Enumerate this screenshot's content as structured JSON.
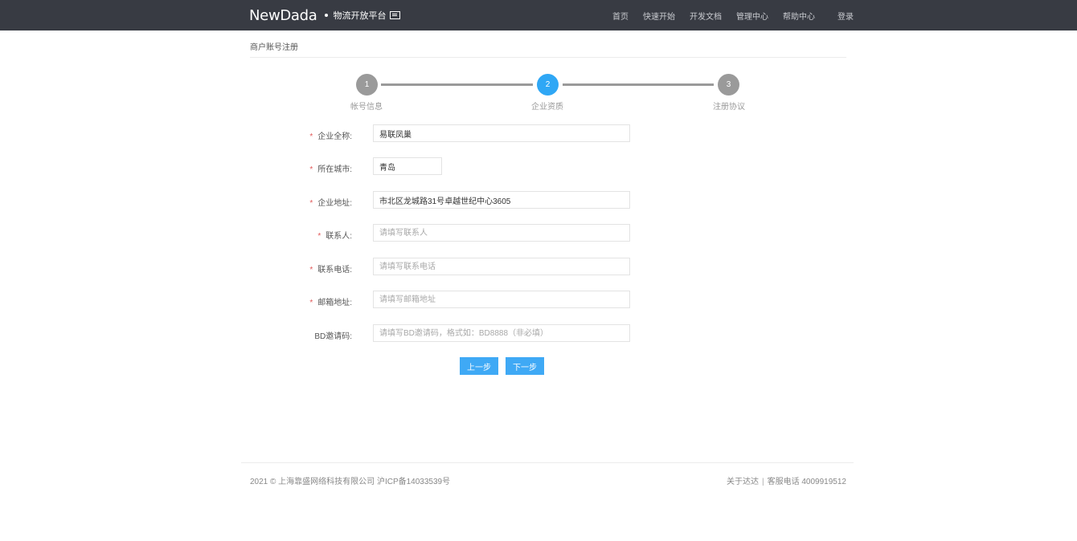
{
  "header": {
    "logo_text": "NewDada",
    "subtitle": "物流开放平台",
    "nav": [
      "首页",
      "快速开始",
      "开发文档",
      "管理中心",
      "帮助中心"
    ],
    "login_label": "登录"
  },
  "page": {
    "title": "商户账号注册"
  },
  "steps": [
    {
      "number": "1",
      "label": "帐号信息",
      "active": false
    },
    {
      "number": "2",
      "label": "企业资质",
      "active": true
    },
    {
      "number": "3",
      "label": "注册协议",
      "active": false
    }
  ],
  "form": {
    "required_mark": "*",
    "company_name": {
      "label": "企业全称:",
      "value": "易联凤巢",
      "placeholder": ""
    },
    "city": {
      "label": "所在城市:",
      "value": "青岛",
      "placeholder": ""
    },
    "address": {
      "label": "企业地址:",
      "value": "市北区龙城路31号卓越世纪中心3605",
      "placeholder": ""
    },
    "contact": {
      "label": "联系人:",
      "value": "",
      "placeholder": "请填写联系人"
    },
    "phone": {
      "label": "联系电话:",
      "value": "",
      "placeholder": "请填写联系电话"
    },
    "email": {
      "label": "邮箱地址:",
      "value": "",
      "placeholder": "请填写邮箱地址"
    },
    "bd_code": {
      "label": "BD邀请码:",
      "value": "",
      "placeholder": "请填写BD邀请码，格式如：BD8888（非必填）"
    }
  },
  "buttons": {
    "prev": "上一步",
    "next": "下一步"
  },
  "footer": {
    "copyright": "2021 © 上海靠盛网络科技有限公司 沪ICP备14033539号",
    "about": "关于达达",
    "separator": "|",
    "service_phone": "客服电话 4009919512"
  },
  "colors": {
    "header_bg": "#383b43",
    "accent": "#3fa9f5",
    "step_inactive": "#9a9a9a",
    "required": "#e25a5a"
  }
}
